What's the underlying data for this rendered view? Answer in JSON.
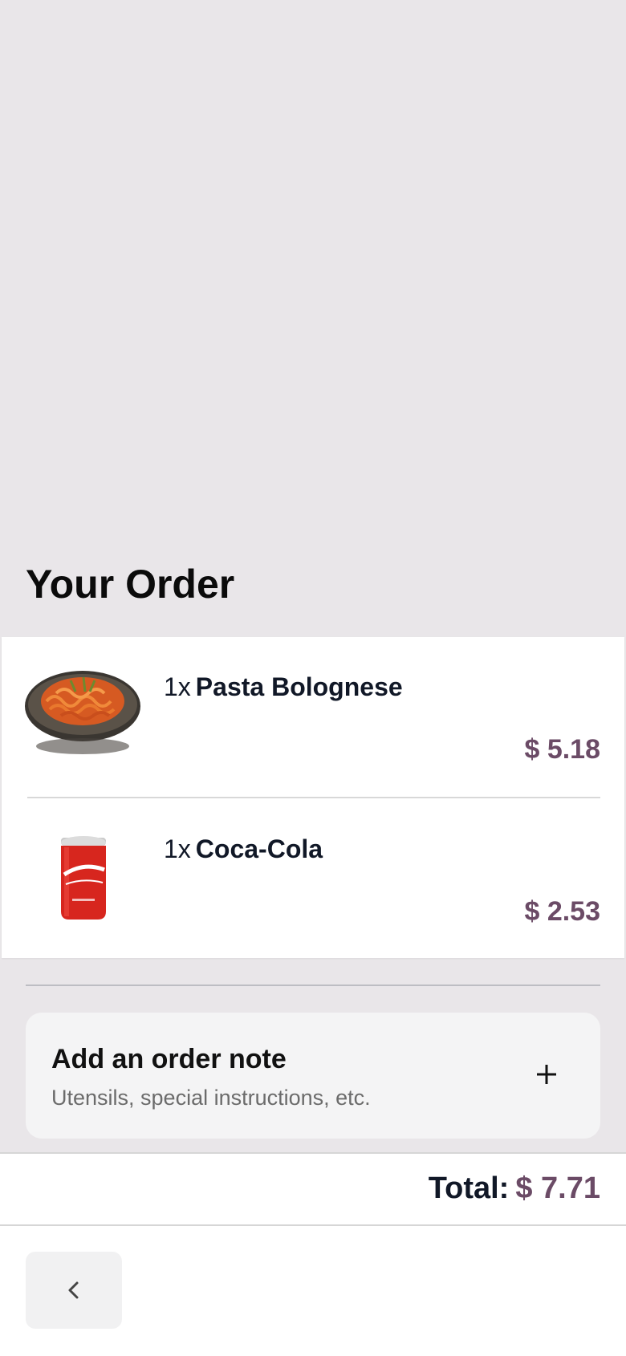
{
  "page": {
    "title": "Your Order"
  },
  "order": {
    "items": [
      {
        "quantity": "1x",
        "name": "Pasta Bolognese",
        "price": "$ 5.18",
        "image_icon": "pasta-bowl-image"
      },
      {
        "quantity": "1x",
        "name": "Coca-Cola",
        "price": "$ 2.53",
        "image_icon": "soda-can-image"
      }
    ]
  },
  "note": {
    "title": "Add an order note",
    "subtitle": "Utensils, special instructions, etc.",
    "icon": "plus-icon"
  },
  "footer": {
    "total_label": "Total:",
    "total_value": "$ 7.71",
    "back_icon": "chevron-left-icon"
  },
  "colors": {
    "background": "#e9e6e9",
    "price_accent": "#6b4b66",
    "card": "#ffffff",
    "note_card": "#f4f4f5"
  }
}
